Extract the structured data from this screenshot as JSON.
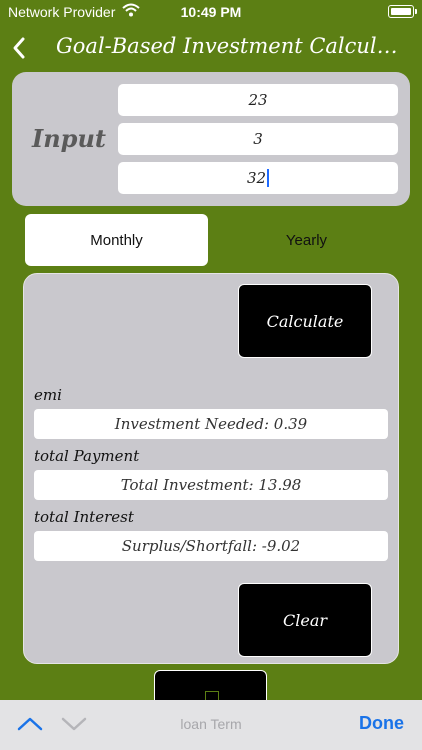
{
  "status_bar": {
    "carrier": "Network Provider",
    "time": "10:49 PM"
  },
  "nav": {
    "title": "Goal-Based Investment Calculat..."
  },
  "input_section": {
    "label": "Input",
    "fields": [
      {
        "value": "23"
      },
      {
        "value": "3"
      },
      {
        "value": "32"
      }
    ]
  },
  "segment": {
    "monthly": "Monthly",
    "yearly": "Yearly",
    "selected": "Monthly"
  },
  "results": {
    "calculate_label": "Calculate",
    "emi_label": "emi",
    "emi_value": "Investment Needed: 0.39",
    "total_payment_label": "total Payment",
    "total_payment_value": "Total Investment: 13.98",
    "total_interest_label": "total Interest",
    "total_interest_value": "Surplus/Shortfall: -9.02",
    "clear_label": "Clear"
  },
  "keyboard_accessory": {
    "title": "loan Term",
    "done_label": "Done"
  },
  "colors": {
    "background": "#5c7f14",
    "card": "#c9c8cd",
    "accent": "#1a73e8"
  }
}
